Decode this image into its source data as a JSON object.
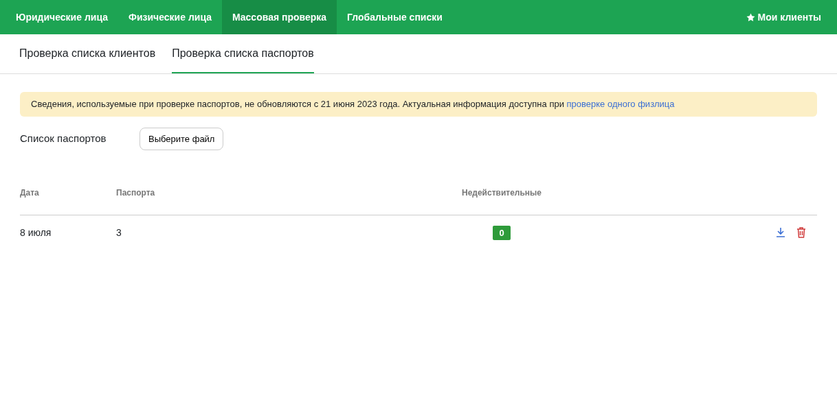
{
  "navbar": {
    "items": [
      {
        "label": "Юридические лица",
        "selected": false
      },
      {
        "label": "Физические лица",
        "selected": false
      },
      {
        "label": "Массовая проверка",
        "selected": true
      },
      {
        "label": "Глобальные списки",
        "selected": false
      }
    ],
    "right_link": {
      "label": "Мои клиенты"
    }
  },
  "tabs": [
    {
      "label": "Проверка списка клиентов",
      "selected": false
    },
    {
      "label": "Проверка списка паспортов",
      "selected": true
    }
  ],
  "alert": {
    "text": "Сведения, используемые при проверке паспортов, не обновляются с 21 июня 2023 года. Актуальная информация доступна при ",
    "link": "проверке одного физлица"
  },
  "upload": {
    "label": "Список паспортов",
    "button": "Выберите файл"
  },
  "table": {
    "columns": [
      "Дата",
      "Паспорта",
      "Недействительные"
    ],
    "rows": [
      {
        "date": "8 июля",
        "passports": "3",
        "invalid": "0"
      }
    ]
  }
}
